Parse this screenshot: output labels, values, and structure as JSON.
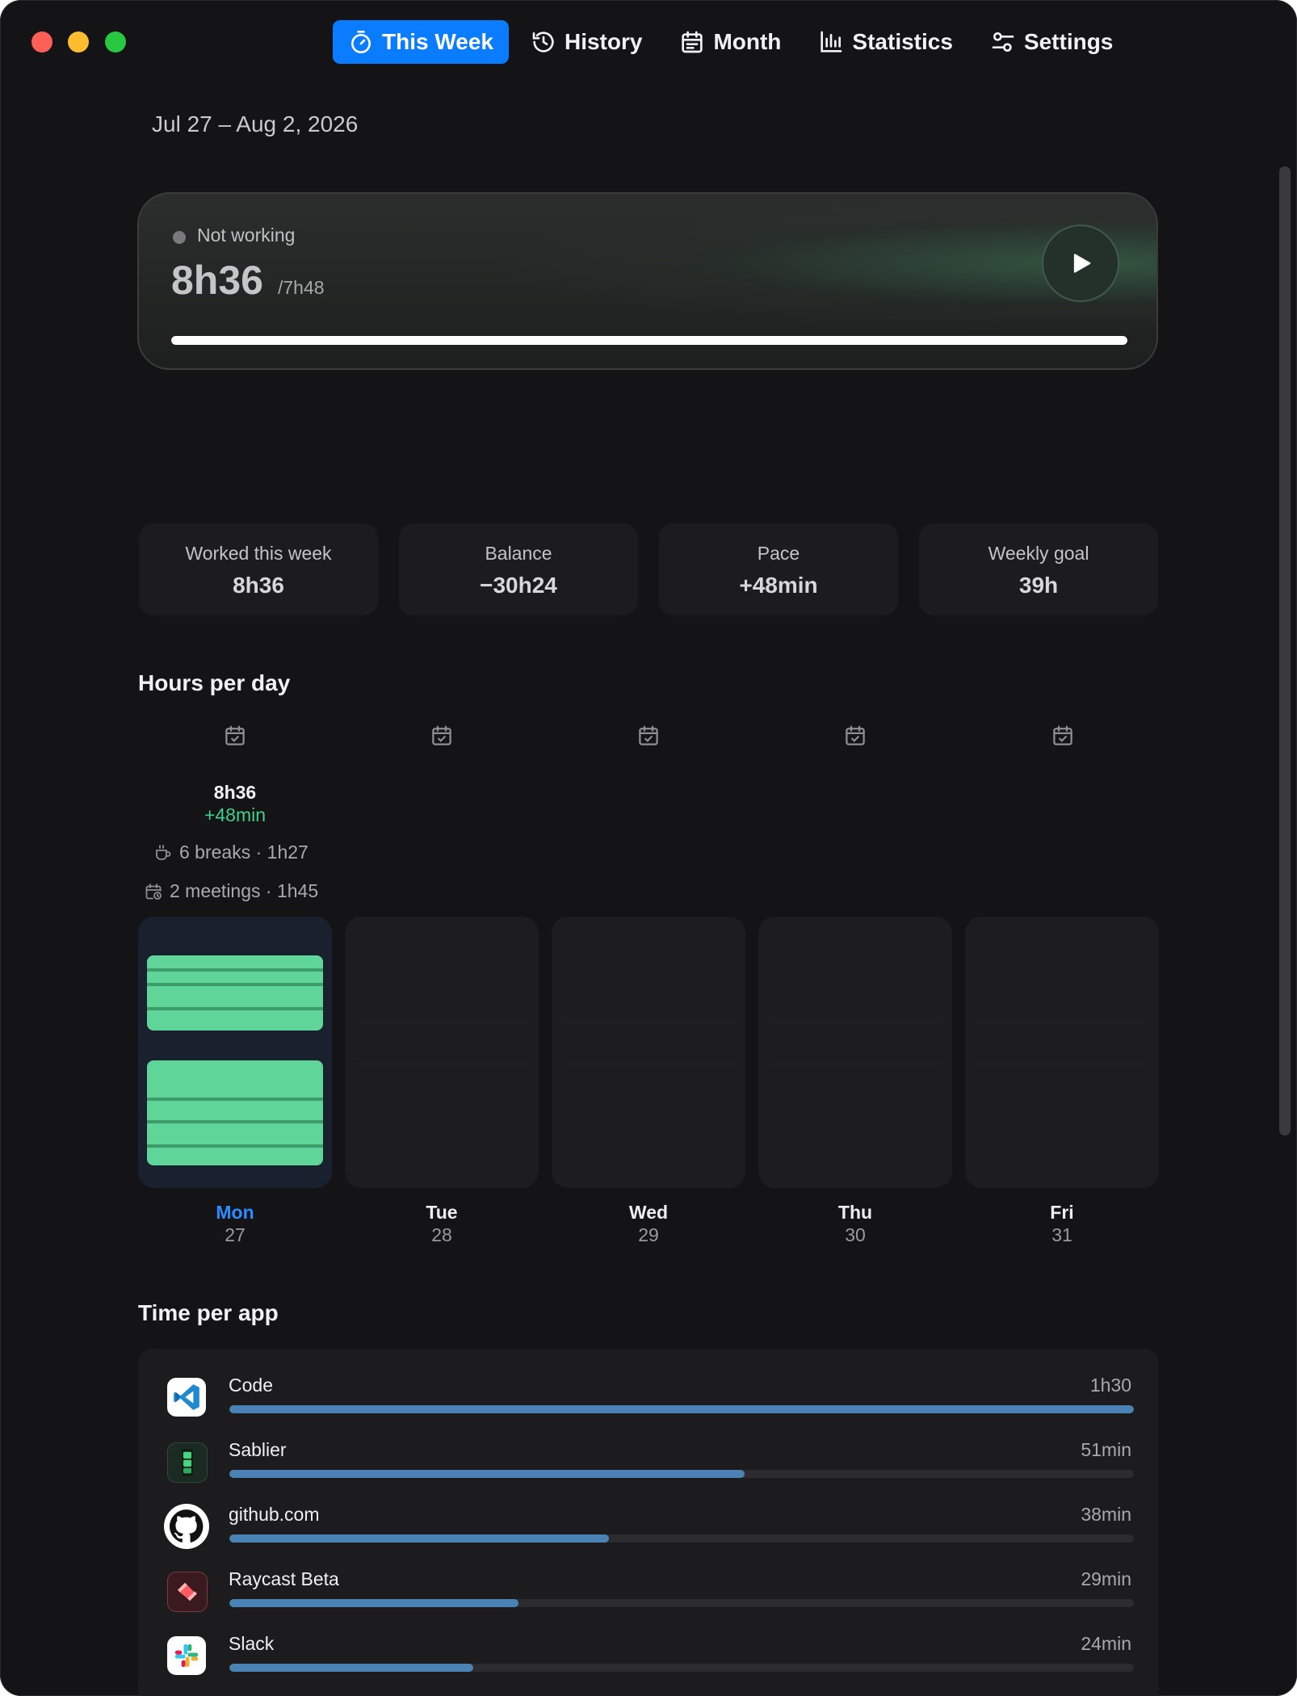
{
  "window": {
    "traffic_lights": [
      "close",
      "minimize",
      "zoom"
    ]
  },
  "nav": {
    "tabs": [
      {
        "label": "This Week",
        "icon": "stopwatch-icon",
        "active": true
      },
      {
        "label": "History",
        "icon": "history-icon",
        "active": false
      },
      {
        "label": "Month",
        "icon": "calendar-icon",
        "active": false
      },
      {
        "label": "Statistics",
        "icon": "bar-chart-icon",
        "active": false
      },
      {
        "label": "Settings",
        "icon": "sliders-icon",
        "active": false
      }
    ]
  },
  "header": {
    "date_range": "Jul 27 – Aug 2, 2026"
  },
  "timer": {
    "status": "Not working",
    "elapsed": "8h36",
    "target": "/7h48",
    "progress": 1.0,
    "play_icon": "play-icon"
  },
  "stats": [
    {
      "label": "Worked this week",
      "value": "8h36"
    },
    {
      "label": "Balance",
      "value": "−30h24"
    },
    {
      "label": "Pace",
      "value": "+48min"
    },
    {
      "label": "Weekly goal",
      "value": "39h"
    }
  ],
  "hours_per_day": {
    "title": "Hours per day",
    "monday": {
      "total": "8h36",
      "delta": "+48min",
      "breaks": "6 breaks · 1h27",
      "meetings": "2 meetings · 1h45"
    },
    "days": [
      {
        "name": "Mon",
        "num": "27",
        "selected": true
      },
      {
        "name": "Tue",
        "num": "28",
        "selected": false
      },
      {
        "name": "Wed",
        "num": "29",
        "selected": false
      },
      {
        "name": "Thu",
        "num": "30",
        "selected": false
      },
      {
        "name": "Fri",
        "num": "31",
        "selected": false
      }
    ]
  },
  "time_per_app": {
    "title": "Time per app",
    "apps": [
      {
        "name": "Code",
        "time": "1h30",
        "fraction": 1.0,
        "icon": "vscode-icon"
      },
      {
        "name": "Sablier",
        "time": "51min",
        "fraction": 0.57,
        "icon": "sablier-icon"
      },
      {
        "name": "github.com",
        "time": "38min",
        "fraction": 0.42,
        "icon": "github-icon"
      },
      {
        "name": "Raycast Beta",
        "time": "29min",
        "fraction": 0.32,
        "icon": "raycast-icon"
      },
      {
        "name": "Slack",
        "time": "24min",
        "fraction": 0.27,
        "icon": "slack-icon"
      }
    ]
  },
  "colors": {
    "accent": "#0a7cff",
    "positive": "#3fd08d",
    "work_block": "#5fd59a",
    "app_bar": "#4a82b3",
    "background": "#141416"
  }
}
